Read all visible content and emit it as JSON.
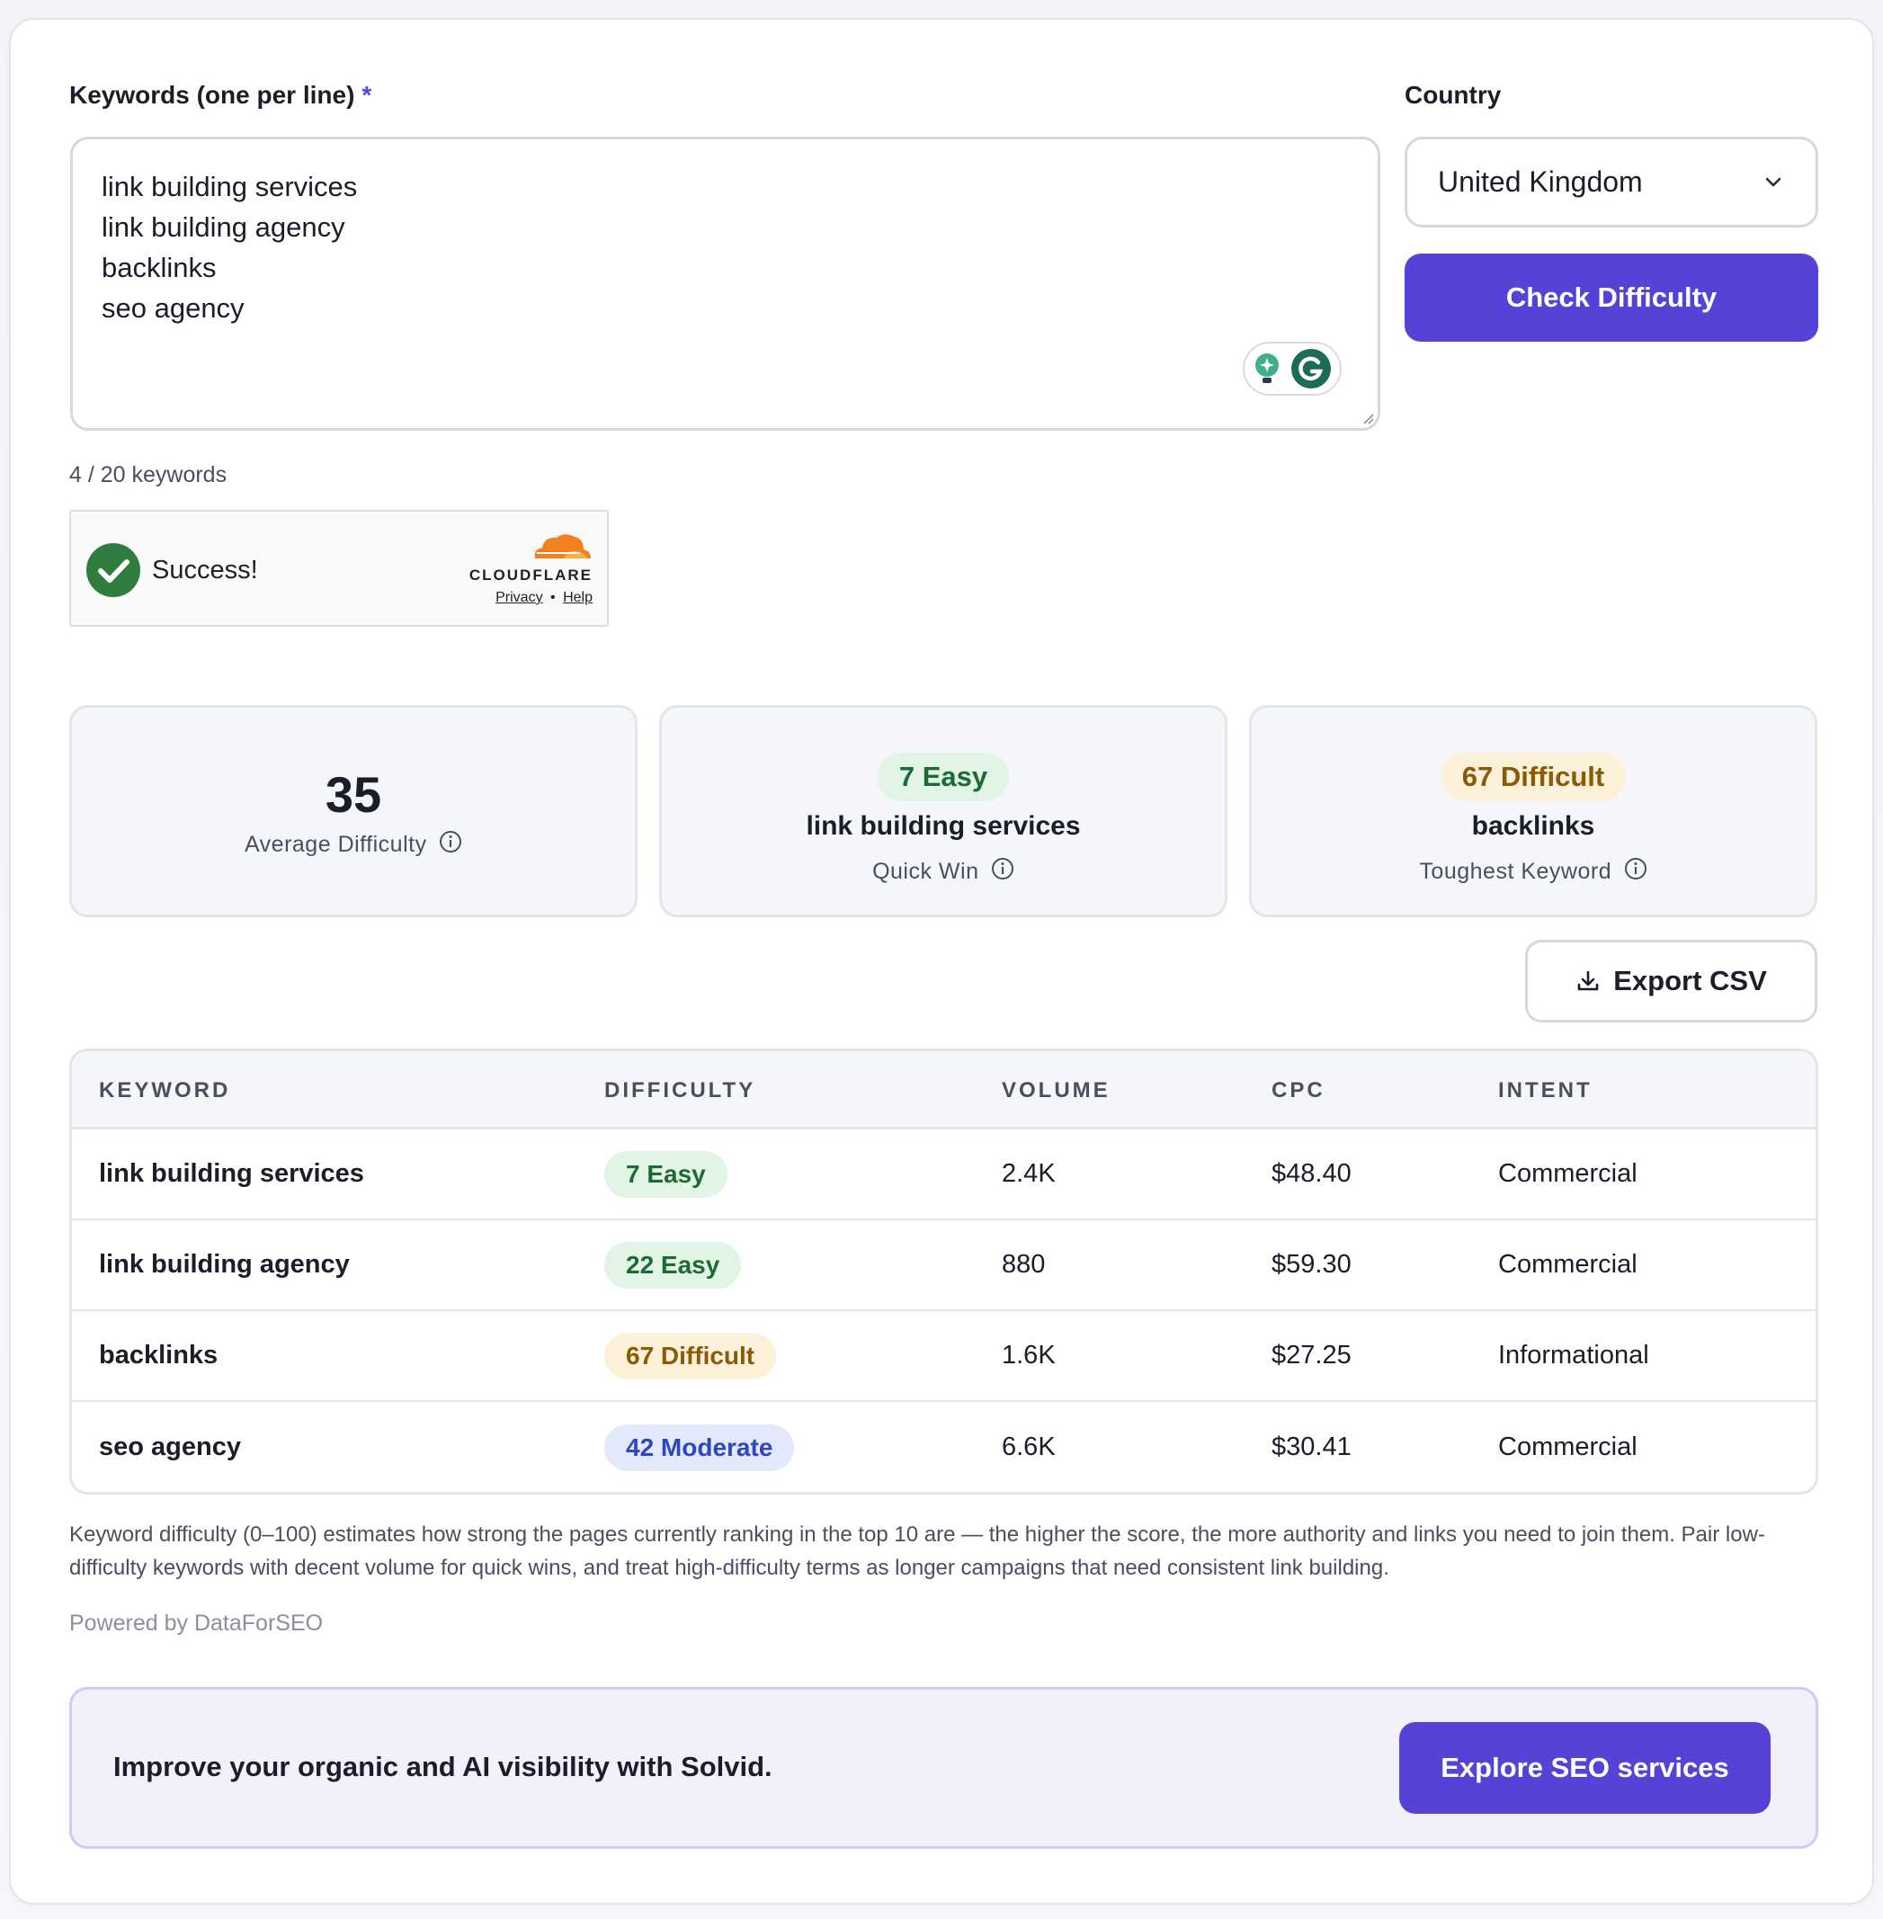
{
  "form": {
    "keywords_label": "Keywords (one per line)",
    "required_mark": "*",
    "keywords": [
      "link building services",
      "link building agency",
      "backlinks",
      "seo agency"
    ],
    "keyword_count": "4 / 20 keywords",
    "country_label": "Country",
    "country_value": "United Kingdom",
    "submit_label": "Check Difficulty"
  },
  "captcha": {
    "status": "Success!",
    "brand": "CLOUDFLARE",
    "privacy": "Privacy",
    "separator": "•",
    "help": "Help"
  },
  "stats": {
    "average": {
      "value": "35",
      "label": "Average Difficulty"
    },
    "quick_win": {
      "badge": "7 Easy",
      "keyword": "link building services",
      "label": "Quick Win"
    },
    "toughest": {
      "badge": "67 Difficult",
      "keyword": "backlinks",
      "label": "Toughest Keyword"
    }
  },
  "export_label": "Export CSV",
  "table": {
    "headers": [
      "KEYWORD",
      "DIFFICULTY",
      "VOLUME",
      "CPC",
      "INTENT"
    ],
    "rows": [
      {
        "keyword": "link building services",
        "difficulty": "7 Easy",
        "level": "easy",
        "volume": "2.4K",
        "cpc": "$48.40",
        "intent": "Commercial"
      },
      {
        "keyword": "link building agency",
        "difficulty": "22 Easy",
        "level": "easy",
        "volume": "880",
        "cpc": "$59.30",
        "intent": "Commercial"
      },
      {
        "keyword": "backlinks",
        "difficulty": "67 Difficult",
        "level": "hard",
        "volume": "1.6K",
        "cpc": "$27.25",
        "intent": "Informational"
      },
      {
        "keyword": "seo agency",
        "difficulty": "42 Moderate",
        "level": "mod",
        "volume": "6.6K",
        "cpc": "$30.41",
        "intent": "Commercial"
      }
    ]
  },
  "note": "Keyword difficulty (0–100) estimates how strong the pages currently ranking in the top 10 are — the higher the score, the more authority and links you need to join them. Pair low-difficulty keywords with decent volume for quick wins, and treat high-difficulty terms as longer campaigns that need consistent link building.",
  "powered_by": "Powered by DataForSEO",
  "promo": {
    "text": "Improve your organic and AI visibility with Solvid.",
    "button": "Explore SEO services"
  },
  "colors": {
    "primary": "#5443d6",
    "easy_bg": "#e2f4e6",
    "easy_fg": "#1d6b33",
    "hard_bg": "#fdf1d9",
    "hard_fg": "#8a5a05",
    "mod_bg": "#e3e9fb",
    "mod_fg": "#2d46c2"
  },
  "icons": [
    "chevron-down-icon",
    "info-icon",
    "download-icon",
    "checkmark-icon",
    "cloudflare-logo",
    "grammarly-icon",
    "lightbulb-icon"
  ]
}
